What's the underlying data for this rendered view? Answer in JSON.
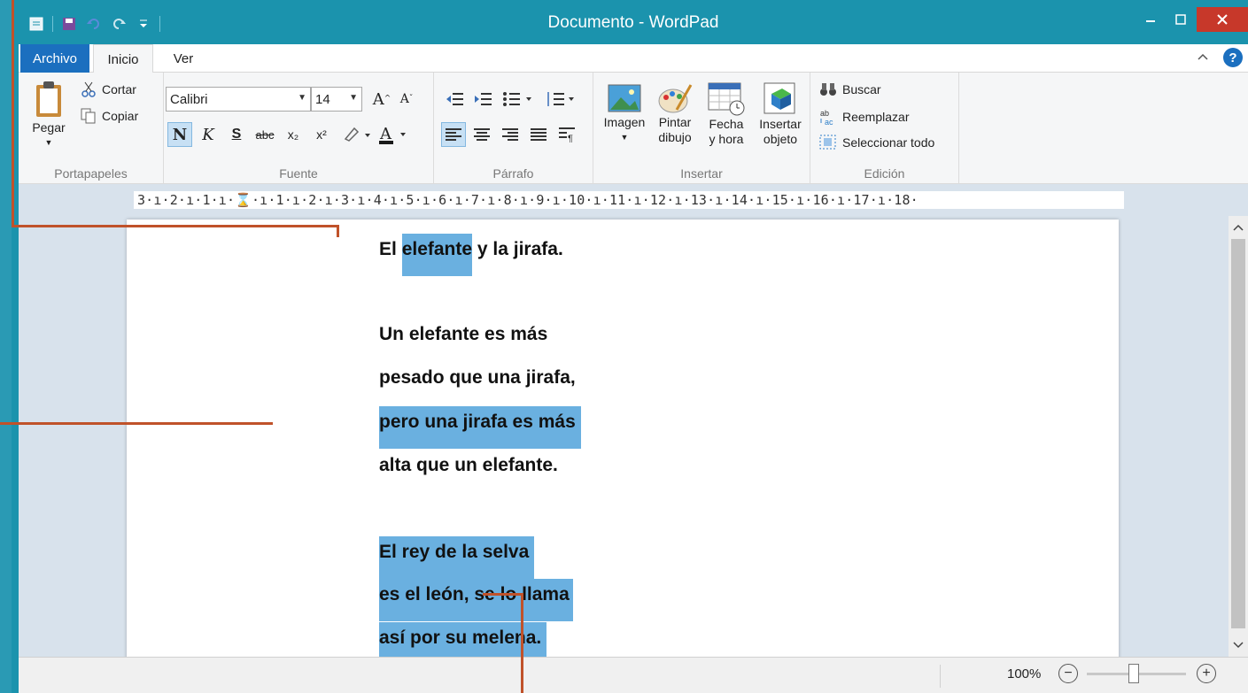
{
  "window": {
    "title": "Documento - WordPad"
  },
  "tabs": [
    {
      "label": "Archivo"
    },
    {
      "label": "Inicio"
    },
    {
      "label": "Ver"
    }
  ],
  "ribbon": {
    "portapapeles": {
      "label": "Portapapeles",
      "paste": "Pegar",
      "cut": "Cortar",
      "copy": "Copiar"
    },
    "fuente": {
      "label": "Fuente",
      "font_name": "Calibri",
      "font_size": "14",
      "bold": "N",
      "italic": "K",
      "underline": "S",
      "strikethrough": "abc",
      "subscript": "x₂",
      "superscript": "x²"
    },
    "parrafo": {
      "label": "Párrafo"
    },
    "insertar": {
      "label": "Insertar",
      "image": "Imagen",
      "paint_line1": "Pintar",
      "paint_line2": "dibujo",
      "date_line1": "Fecha",
      "date_line2": "y hora",
      "object_line1": "Insertar",
      "object_line2": "objeto"
    },
    "edicion": {
      "label": "Edición",
      "find": "Buscar",
      "replace": "Reemplazar",
      "select_all": "Seleccionar todo"
    }
  },
  "ruler": {
    "text": "3·ı·2·ı·1·ı·⌛·ı·1·ı·2·ı·3·ı·4·ı·5·ı·6·ı·7·ı·8·ı·9·ı·10·ı·11·ı·12·ı·13·ı·14·ı·15·ı·16·ı·17·ı·18·"
  },
  "document": {
    "line1_pre": "El ",
    "line1_sel": "elefante",
    "line1_post": " y la jirafa.",
    "line2": "Un elefante es más",
    "line3": "pesado que una jirafa,",
    "line4": "pero una jirafa es más",
    "line5": "alta que un elefante.",
    "line6": "El rey de la selva",
    "line7": "es el león, se lo llama",
    "line8": "así por su melena."
  },
  "status": {
    "zoom": "100%"
  },
  "colors": {
    "titlebar": "#1b93ad",
    "selection": "#6ab0e0",
    "callout": "#c0522a",
    "file_tab": "#1b6fbf",
    "close": "#c7382a"
  }
}
